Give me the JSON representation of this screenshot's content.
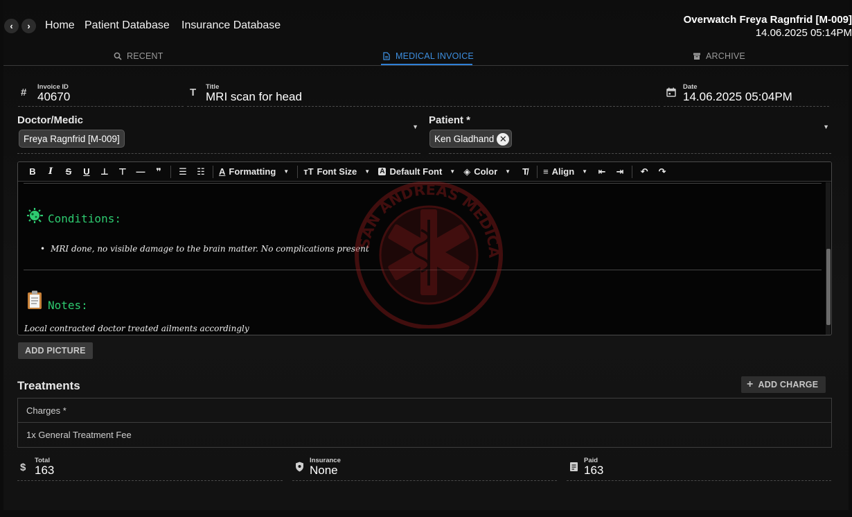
{
  "header": {
    "nav_back_icon": "chevron-left-icon",
    "nav_forward_icon": "chevron-right-icon",
    "links": [
      "Home",
      "Patient Database",
      "Insurance Database"
    ],
    "user_name": "Overwatch Freya Ragnfrid [M-009]",
    "datetime": "14.06.2025 05:14PM"
  },
  "tabs": [
    {
      "label": "RECENT",
      "icon": "search-icon"
    },
    {
      "label": "MEDICAL INVOICE",
      "icon": "document-icon",
      "active": true
    },
    {
      "label": "ARCHIVE",
      "icon": "archive-icon"
    }
  ],
  "invoice": {
    "id_label": "Invoice ID",
    "id_value": "40670",
    "title_label": "Title",
    "title_value": "MRI scan for head",
    "date_label": "Date",
    "date_value": "14.06.2025 05:04PM"
  },
  "doctor": {
    "label": "Doctor/Medic",
    "value": "Freya Ragnfrid [M-009]"
  },
  "patient": {
    "label": "Patient *",
    "value": "Ken Gladhand"
  },
  "toolbar": {
    "bold": "B",
    "italic": "I",
    "formatting": "Formatting",
    "font_size": "Font Size",
    "default_font": "Default Font",
    "color": "Color",
    "align": "Align"
  },
  "editor": {
    "conditions_heading": "Conditions:",
    "conditions_item": "MRI done, no visible damage to the brain matter. No complications present",
    "notes_heading": "Notes:",
    "notes_text": "Local contracted doctor treated ailments accordingly",
    "watermark_text": "SAN ANDREAS MEDICAL SERVICES"
  },
  "add_picture": "ADD PICTURE",
  "treatments": {
    "title": "Treatments",
    "add_charge": "ADD CHARGE",
    "charges_header": "Charges *",
    "rows": [
      "1x General Treatment Fee"
    ]
  },
  "totals": {
    "total_label": "Total",
    "total_value": "163",
    "insurance_label": "Insurance",
    "insurance_value": "None",
    "paid_label": "Paid",
    "paid_value": "163"
  },
  "colors": {
    "accent": "#3d8fe0",
    "heading_green": "#2ecc71",
    "watermark_red": "#8b1a1a"
  }
}
